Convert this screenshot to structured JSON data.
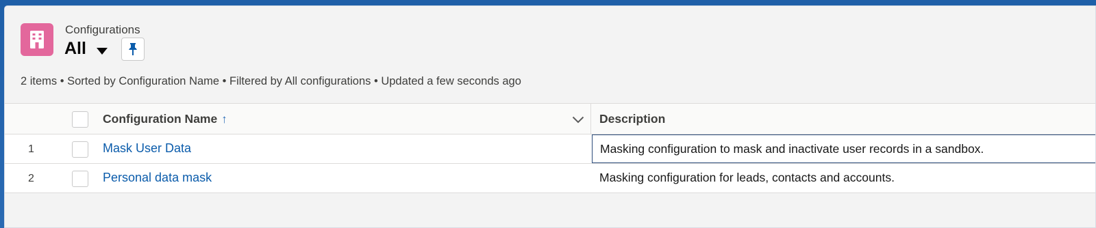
{
  "header": {
    "object_label": "Configurations",
    "view_name": "All",
    "app_icon": "building-icon",
    "pin_icon": "pin-icon",
    "list_info": "2 items • Sorted by Configuration Name • Filtered by All configurations • Updated a few seconds ago"
  },
  "table": {
    "columns": [
      {
        "label": "Configuration Name",
        "sort": "ascending"
      },
      {
        "label": "Description"
      }
    ],
    "sort_arrow": "↑",
    "rows": [
      {
        "num": "1",
        "name": "Mask User Data",
        "description": "Masking configuration to mask and inactivate user records in a sandbox."
      },
      {
        "num": "2",
        "name": "Personal data mask",
        "description": "Masking configuration for leads, contacts and accounts."
      }
    ]
  },
  "colors": {
    "app_icon_bg": "#e3679c",
    "link": "#0b5cab",
    "frame_bg": "#1f5fa8"
  }
}
